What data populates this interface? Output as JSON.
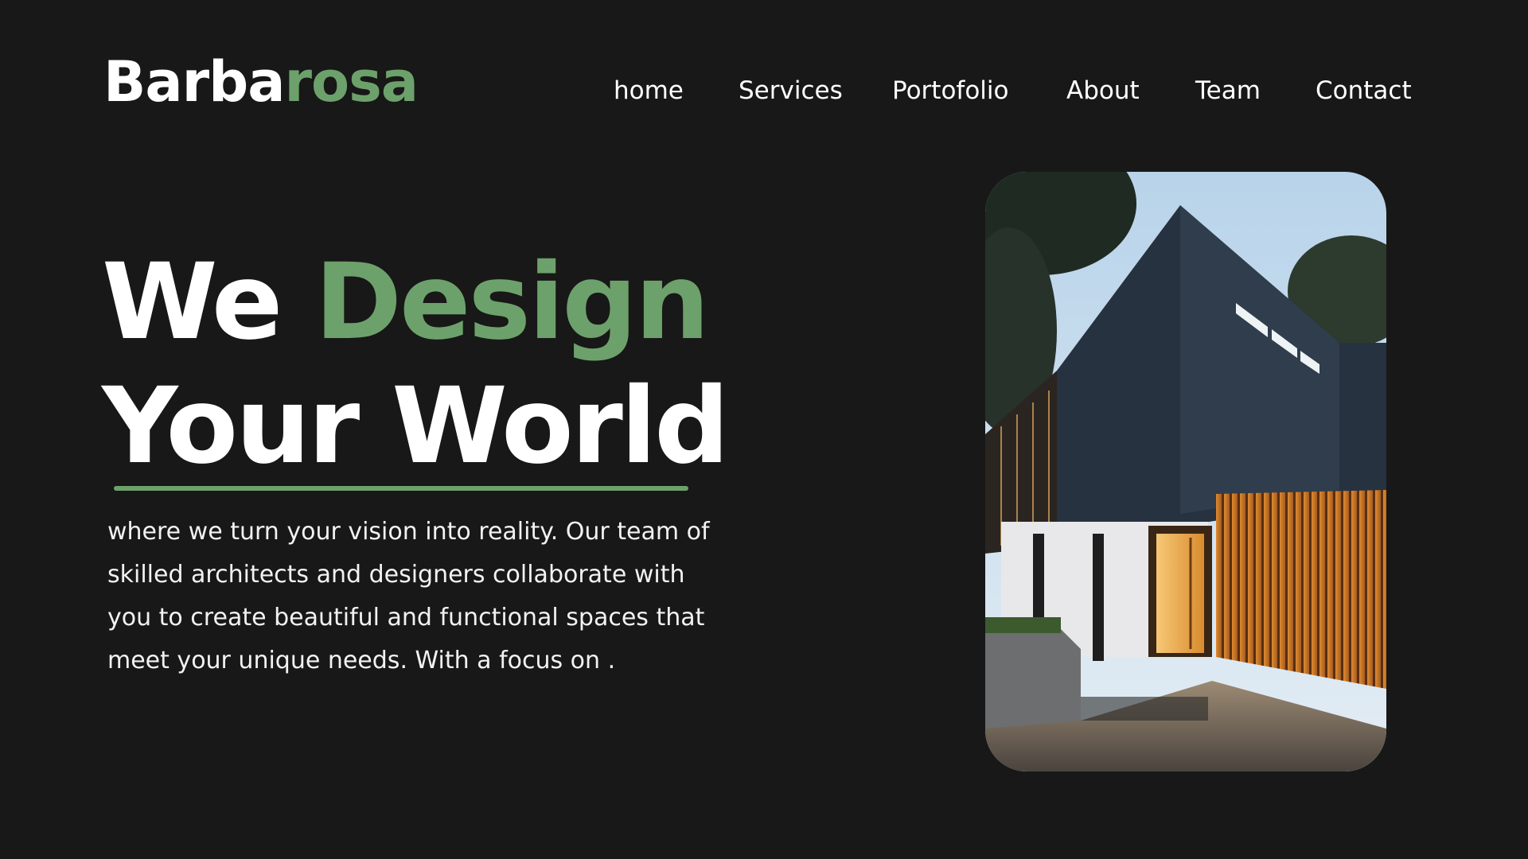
{
  "brand": {
    "name_part1": "Barba",
    "name_part2": "rosa",
    "accent_color": "#6da16b",
    "background_color": "#181818"
  },
  "nav": {
    "items": [
      {
        "label": "home"
      },
      {
        "label": "Services"
      },
      {
        "label": "Portofolio"
      },
      {
        "label": "About"
      },
      {
        "label": "Team"
      },
      {
        "label": "Contact"
      }
    ]
  },
  "hero": {
    "title_word1": "We",
    "title_word2": "Design",
    "title_line2": "Your World",
    "description": "where we turn your vision into reality. Our team of skilled architects and designers collaborate with you to create beautiful and functional spaces that meet your unique needs. With a focus on .",
    "image_subject": "modern-house-at-dusk"
  }
}
